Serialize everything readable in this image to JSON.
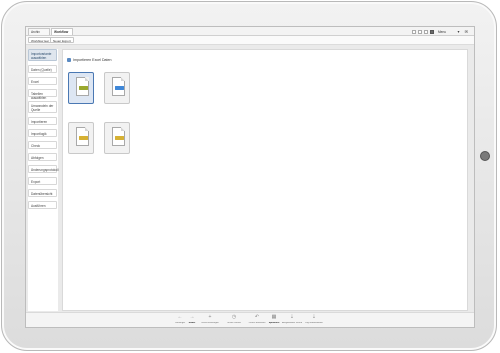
{
  "tabs": [
    {
      "label": "Archiv Excel",
      "active": false
    },
    {
      "label": "Workflow 1",
      "active": true
    }
  ],
  "tab_close": "×",
  "topright": {
    "label": "Menu",
    "icons": "▾ ✉"
  },
  "toolbar": {
    "btn1": "Workflow leer",
    "btn2": "Neuer Export"
  },
  "sidebar_items": [
    "Importvariante auswählen",
    "Daten (Quelle)",
    "Excel",
    "Tabellen auswählen",
    "Umwandeln der Quelle",
    "Importieren",
    "Importlogik",
    "Check",
    "Abfolgen",
    "Änderungsprotokoll",
    "Export",
    "Datenübersicht",
    "Ausführen"
  ],
  "main_header": "Importieren Excel Daten",
  "files": [
    {
      "tag_color": "#9aa82e",
      "selected": true
    },
    {
      "tag_color": "#3f87d8",
      "selected": false
    },
    {
      "tag_color": "#d6b133",
      "selected": false
    },
    {
      "tag_color": "#d6b133",
      "selected": false
    }
  ],
  "bottom_actions": [
    {
      "icon": "←",
      "label": "Vorheriger",
      "bold": false
    },
    {
      "icon": "→",
      "label": "Weiter",
      "bold": true
    },
    {
      "icon": "+",
      "label": "Schritt hinzufügen",
      "bold": false
    },
    {
      "icon": "◷",
      "label": "Schritt Verlauf",
      "bold": false
    },
    {
      "icon": "↶",
      "label": "Zurück Entfernen",
      "bold": false
    },
    {
      "icon": "▦",
      "label": "Speichern",
      "bold": true
    },
    {
      "icon": "⇣",
      "label": "Ausgewählter Schritt",
      "bold": false
    },
    {
      "icon": "⇣",
      "label": "Log Informationen",
      "bold": false
    }
  ]
}
